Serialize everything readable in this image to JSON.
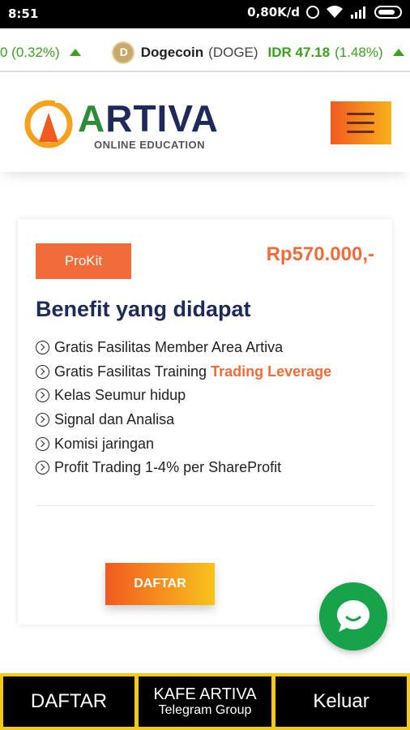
{
  "status_bar": {
    "time": "8:51",
    "network_speed": "0,80K/d"
  },
  "ticker": {
    "prev_change": "0 (0.32%)",
    "coin_name": "Dogecoin",
    "coin_symbol": "(DOGE)",
    "coin_price": "IDR 47.18",
    "coin_change": "(1.48%)",
    "trend": "up",
    "accent_color": "#3c9f1f"
  },
  "header": {
    "logo_letter_a": "A",
    "logo_rest": "RTIVA",
    "logo_sub": "ONLINE EDUCATION"
  },
  "card": {
    "badge": "ProKit",
    "price": "Rp570.000,-",
    "title": "Benefit yang didapat",
    "benefits": [
      {
        "text": "Gratis Fasilitas Member Area Artiva",
        "highlight": ""
      },
      {
        "text": "Gratis Fasilitas Training",
        "highlight": "Trading Leverage"
      },
      {
        "text": "Kelas Seumur hidup",
        "highlight": ""
      },
      {
        "text": "Signal dan Analisa",
        "highlight": ""
      },
      {
        "text": "Komisi jaringan",
        "highlight": ""
      },
      {
        "text": "Profit Trading 1-4% per ShareProfit",
        "highlight": ""
      }
    ],
    "button": "DAFTAR",
    "accent_color": "#f26c3a"
  },
  "bottom_bar": {
    "daftar": "DAFTAR",
    "kafe_title": "KAFE ARTIVA",
    "kafe_sub": "Telegram Group",
    "keluar": "Keluar",
    "border_color": "#f4c91c"
  }
}
